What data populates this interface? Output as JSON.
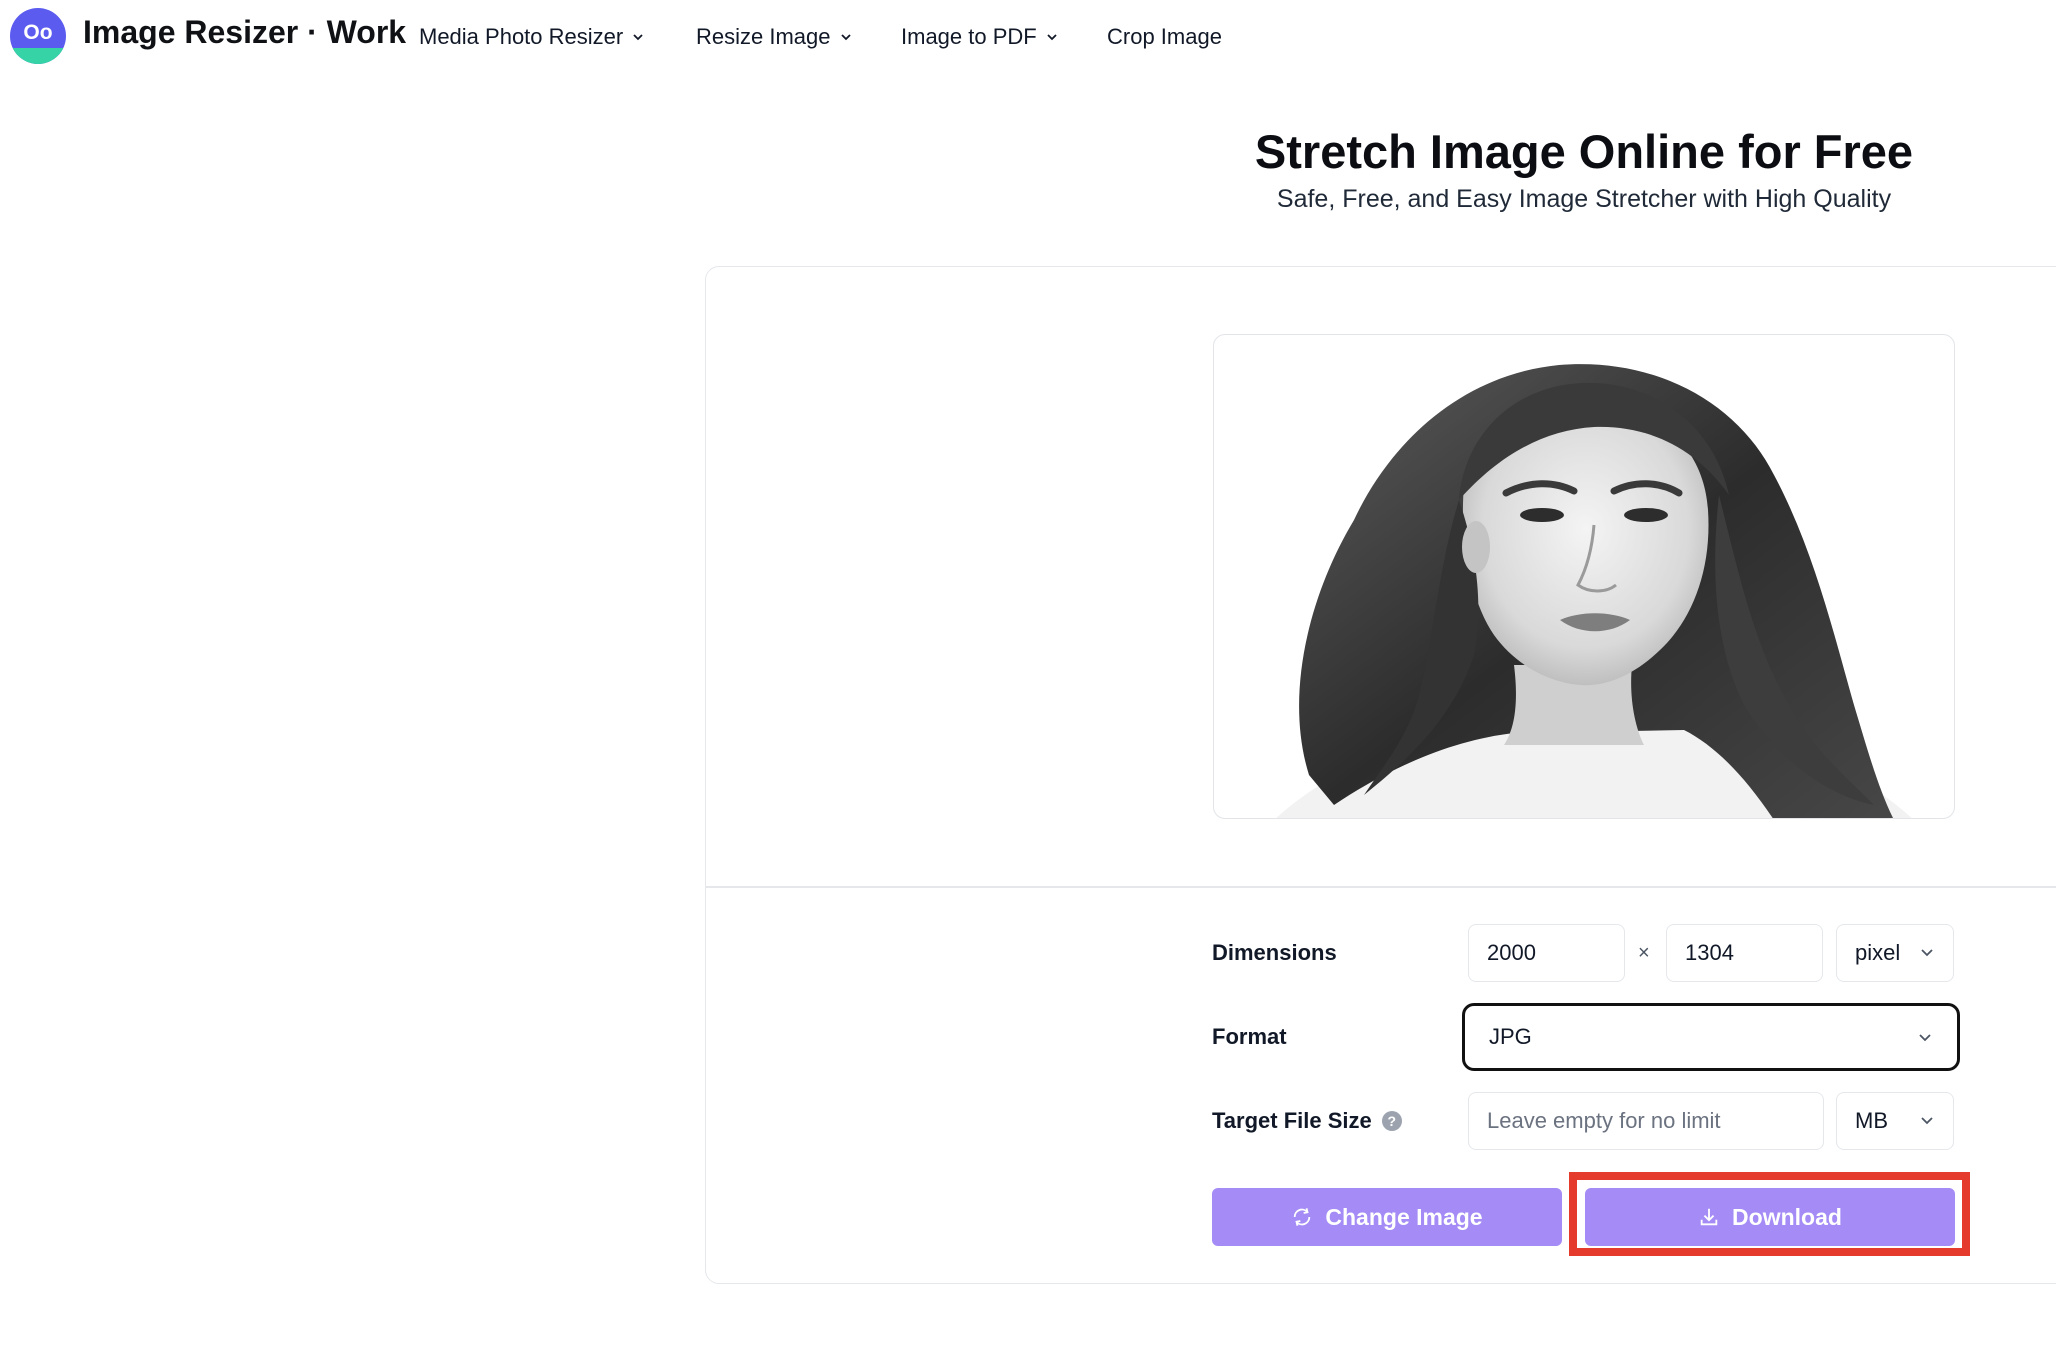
{
  "header": {
    "logo_text": "Oo",
    "brand": "Image Resizer · Work",
    "nav": [
      {
        "label": "Media Photo Resizer",
        "has_dropdown": true
      },
      {
        "label": "Resize Image",
        "has_dropdown": true
      },
      {
        "label": "Image to PDF",
        "has_dropdown": true
      },
      {
        "label": "Crop Image",
        "has_dropdown": false
      }
    ]
  },
  "hero": {
    "title": "Stretch Image Online for Free",
    "subtitle": "Safe, Free, and Easy Image Stretcher with High Quality"
  },
  "form": {
    "dimensions_label": "Dimensions",
    "width_value": "2000",
    "height_value": "1304",
    "times_symbol": "×",
    "unit_value": "pixel",
    "format_label": "Format",
    "format_value": "JPG",
    "target_size_label": "Target File Size",
    "help_glyph": "?",
    "target_size_placeholder": "Leave empty for no limit",
    "size_unit_value": "MB"
  },
  "actions": {
    "change_image_label": "Change Image",
    "download_label": "Download"
  },
  "colors": {
    "accent": "#a48bf5",
    "logo": "#5b5bf0",
    "logo_band": "#35d3a5",
    "highlight": "#e53b2c",
    "focus_border": "#111111"
  },
  "icons": {
    "refresh": "refresh-icon",
    "download": "download-icon",
    "chevron": "chevron-down-icon",
    "help": "help-icon"
  }
}
